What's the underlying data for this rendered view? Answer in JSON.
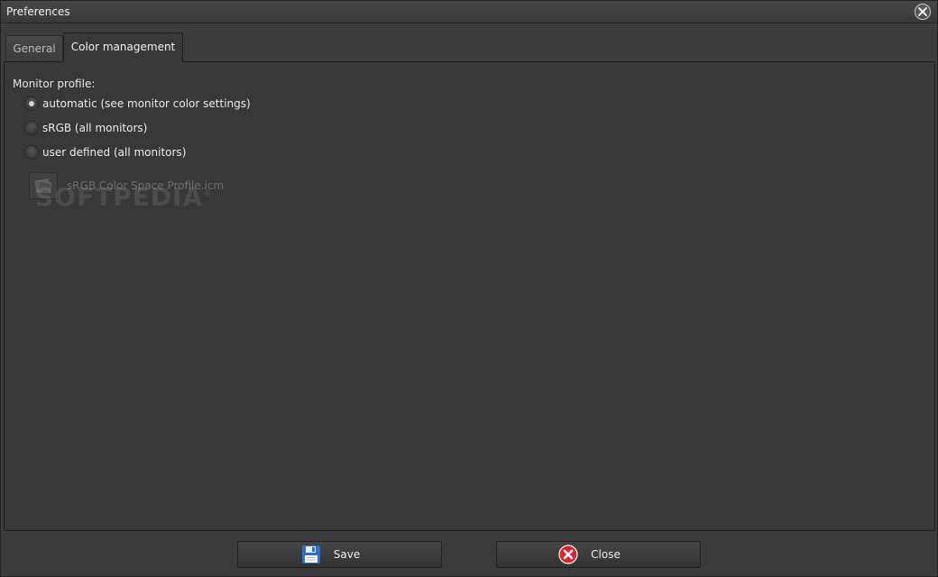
{
  "window": {
    "title": "Preferences"
  },
  "tabs": [
    {
      "label": "General",
      "active": false
    },
    {
      "label": "Color management",
      "active": true
    }
  ],
  "monitor_profile": {
    "label": "Monitor profile:",
    "options": [
      {
        "label": "automatic (see monitor color settings)",
        "checked": true
      },
      {
        "label": "sRGB (all monitors)",
        "checked": false
      },
      {
        "label": "user defined (all monitors)",
        "checked": false
      }
    ],
    "profile_file": "sRGB Color Space Profile.icm"
  },
  "watermark": {
    "text": "SOFTPEDIA",
    "mark": "®"
  },
  "footer": {
    "save_label": "Save",
    "close_label": "Close"
  },
  "icons": {
    "save": "floppy-disk-icon",
    "close": "red-x-icon",
    "title_close": "close-icon",
    "file": "color-profile-icon"
  },
  "colors": {
    "close_red": "#d8242a",
    "save_blue": "#2d6fd0"
  }
}
